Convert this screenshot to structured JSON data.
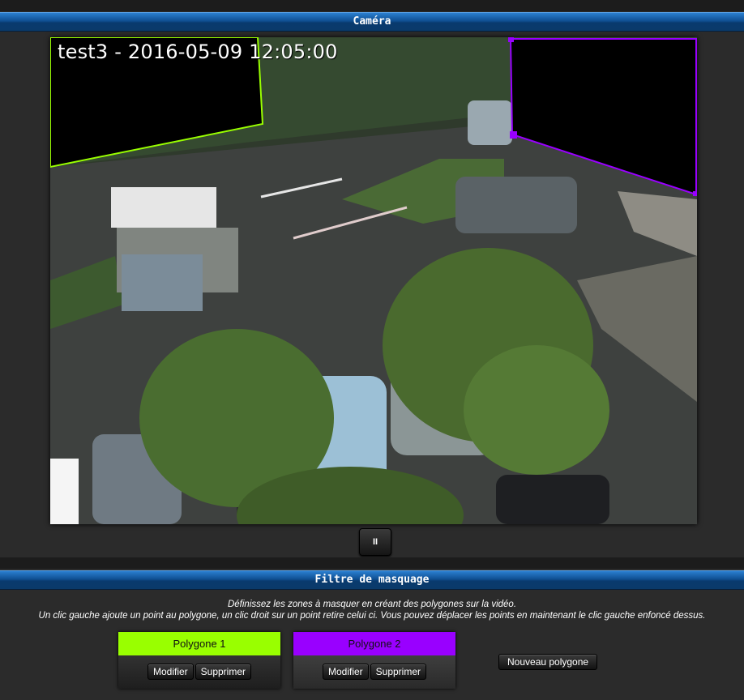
{
  "camera": {
    "title": "Caméra",
    "osd_text": "test3 - 2016-05-09 12:05:00",
    "pause_label": "II"
  },
  "filter": {
    "title": "Filtre de masquage",
    "instructions_line1": "Définissez les zones à masquer en créant des polygones sur la vidéo.",
    "instructions_line2": "Un clic gauche ajoute un point au polygone, un clic droit sur un point retire celui ci. Vous pouvez déplacer les points en maintenant le clic gauche enfoncé dessus.",
    "polygons": [
      {
        "name": "Polygone 1",
        "color": "#99ff00",
        "modify_label": "Modifier",
        "delete_label": "Supprimer"
      },
      {
        "name": "Polygone 2",
        "color": "#9900ff",
        "modify_label": "Modifier",
        "delete_label": "Supprimer"
      }
    ],
    "new_polygon_label": "Nouveau polygone"
  }
}
